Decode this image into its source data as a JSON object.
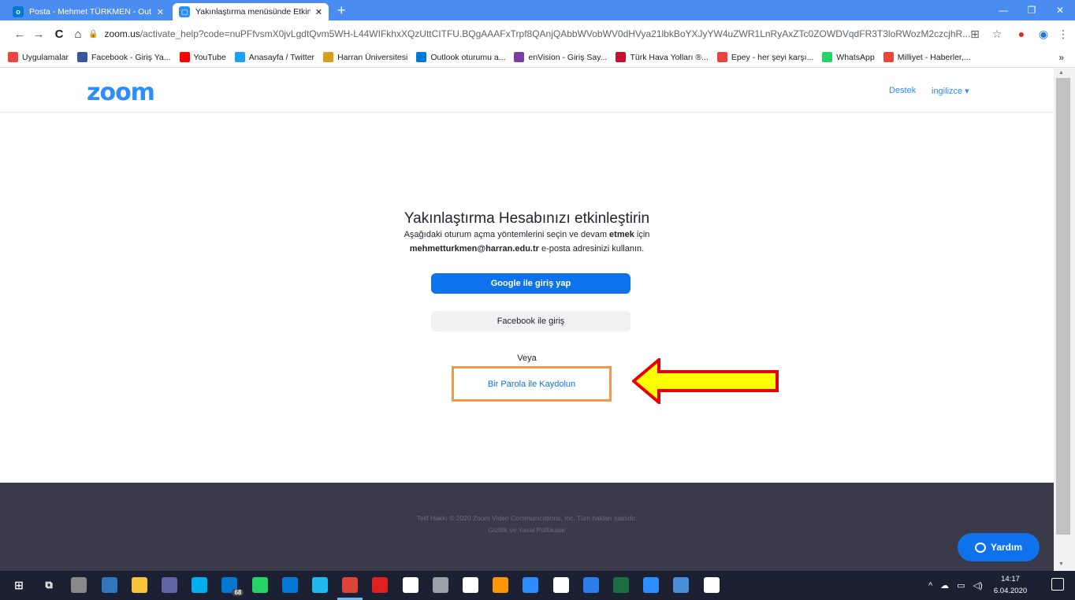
{
  "browser": {
    "tabs": [
      {
        "title": "Posta - Mehmet TÜRKMEN - Out",
        "active": false,
        "icon": "outlook-icon"
      },
      {
        "title": "Yakınlaştırma menüsünde Etkinle",
        "active": true,
        "icon": "zoom-icon"
      }
    ],
    "url_host": "zoom.us",
    "url_rest": "/activate_help?code=nuPFfvsmX0jvLgdtQvm5WH-L44WIFkhxXQzUttCITFU.BQgAAAFxTrpf8QAnjQAbbWVobWV0dHVya21lbkBoYXJyYW4uZWR1LnRyAxZTc0ZOWDVqdFR3T3loRWozM2czcjhR...",
    "bookmarks": [
      {
        "label": "Uygulamalar",
        "icon": "apps-icon",
        "color": "#e8453c"
      },
      {
        "label": "Facebook - Giriş Ya...",
        "icon": "facebook-icon",
        "color": "#3b5998"
      },
      {
        "label": "YouTube",
        "icon": "youtube-icon",
        "color": "#ff0000"
      },
      {
        "label": "Anasayfa / Twitter",
        "icon": "twitter-icon",
        "color": "#1da1f2"
      },
      {
        "label": "Harran Üniversitesi",
        "icon": "university-icon",
        "color": "#d4a017"
      },
      {
        "label": "Outlook oturumu a...",
        "icon": "outlook-icon",
        "color": "#0078d4"
      },
      {
        "label": "enVision - Giriş Say...",
        "icon": "envision-icon",
        "color": "#7b3fa0"
      },
      {
        "label": "Türk Hava Yolları ®...",
        "icon": "thy-icon",
        "color": "#c8102e"
      },
      {
        "label": "Epey - her şeyi karşı...",
        "icon": "epey-icon",
        "color": "#e8453c"
      },
      {
        "label": "WhatsApp",
        "icon": "whatsapp-icon",
        "color": "#25d366"
      },
      {
        "label": "Milliyet - Haberler,...",
        "icon": "milliyet-icon",
        "color": "#e8453c"
      }
    ],
    "bookmarks_more": "»"
  },
  "zoom": {
    "logo": "zoom",
    "support_link": "Destek",
    "language": "ingilizce ▾",
    "title": "Yakınlaştırma Hesabınızı etkinleştirin",
    "desc_line1_pre": "Aşağıdaki oturum açma yöntemlerini seçin ve devam ",
    "desc_line1_bold": "etmek",
    "desc_line1_post": " için",
    "desc_email": "mehmetturkmen@harran.edu.tr",
    "desc_line2_post": " e-posta adresinizi kullanın.",
    "google_button": "Google ile giriş yap",
    "facebook_button": "Facebook ile giriş",
    "or_text": "Veya",
    "password_signup": "Bir Parola ile Kaydolun",
    "footer_copyright": "Telif Hakkı © 2020 Zoom Video Communications, Inc. Tüm hakları saklıdır.",
    "footer_policies": "Gizlilik ve Yasal Politikalar",
    "help_button": "Yardım"
  },
  "annotation": {
    "box_color": "#f5964b",
    "arrow_fill": "#ffff00",
    "arrow_stroke": "#e60000"
  },
  "taskbar": {
    "apps": [
      "start-icon",
      "task-view-icon",
      "terminal-icon",
      "edge-icon",
      "file-explorer-icon",
      "teams-icon",
      "skype-icon",
      "mail-icon",
      "whatsapp-icon",
      "outlook-icon",
      "ie-icon",
      "chrome-icon",
      "acrobat-icon",
      "map-icon",
      "paint-icon",
      "calculator-icon",
      "firefox-icon",
      "zoom-icon",
      "notepad-icon",
      "sketch-icon",
      "excel-icon",
      "zoom-app-icon",
      "photos-icon",
      "gallery-icon"
    ],
    "mail_badge": "68",
    "time": "14:17",
    "date": "6.04.2020"
  }
}
